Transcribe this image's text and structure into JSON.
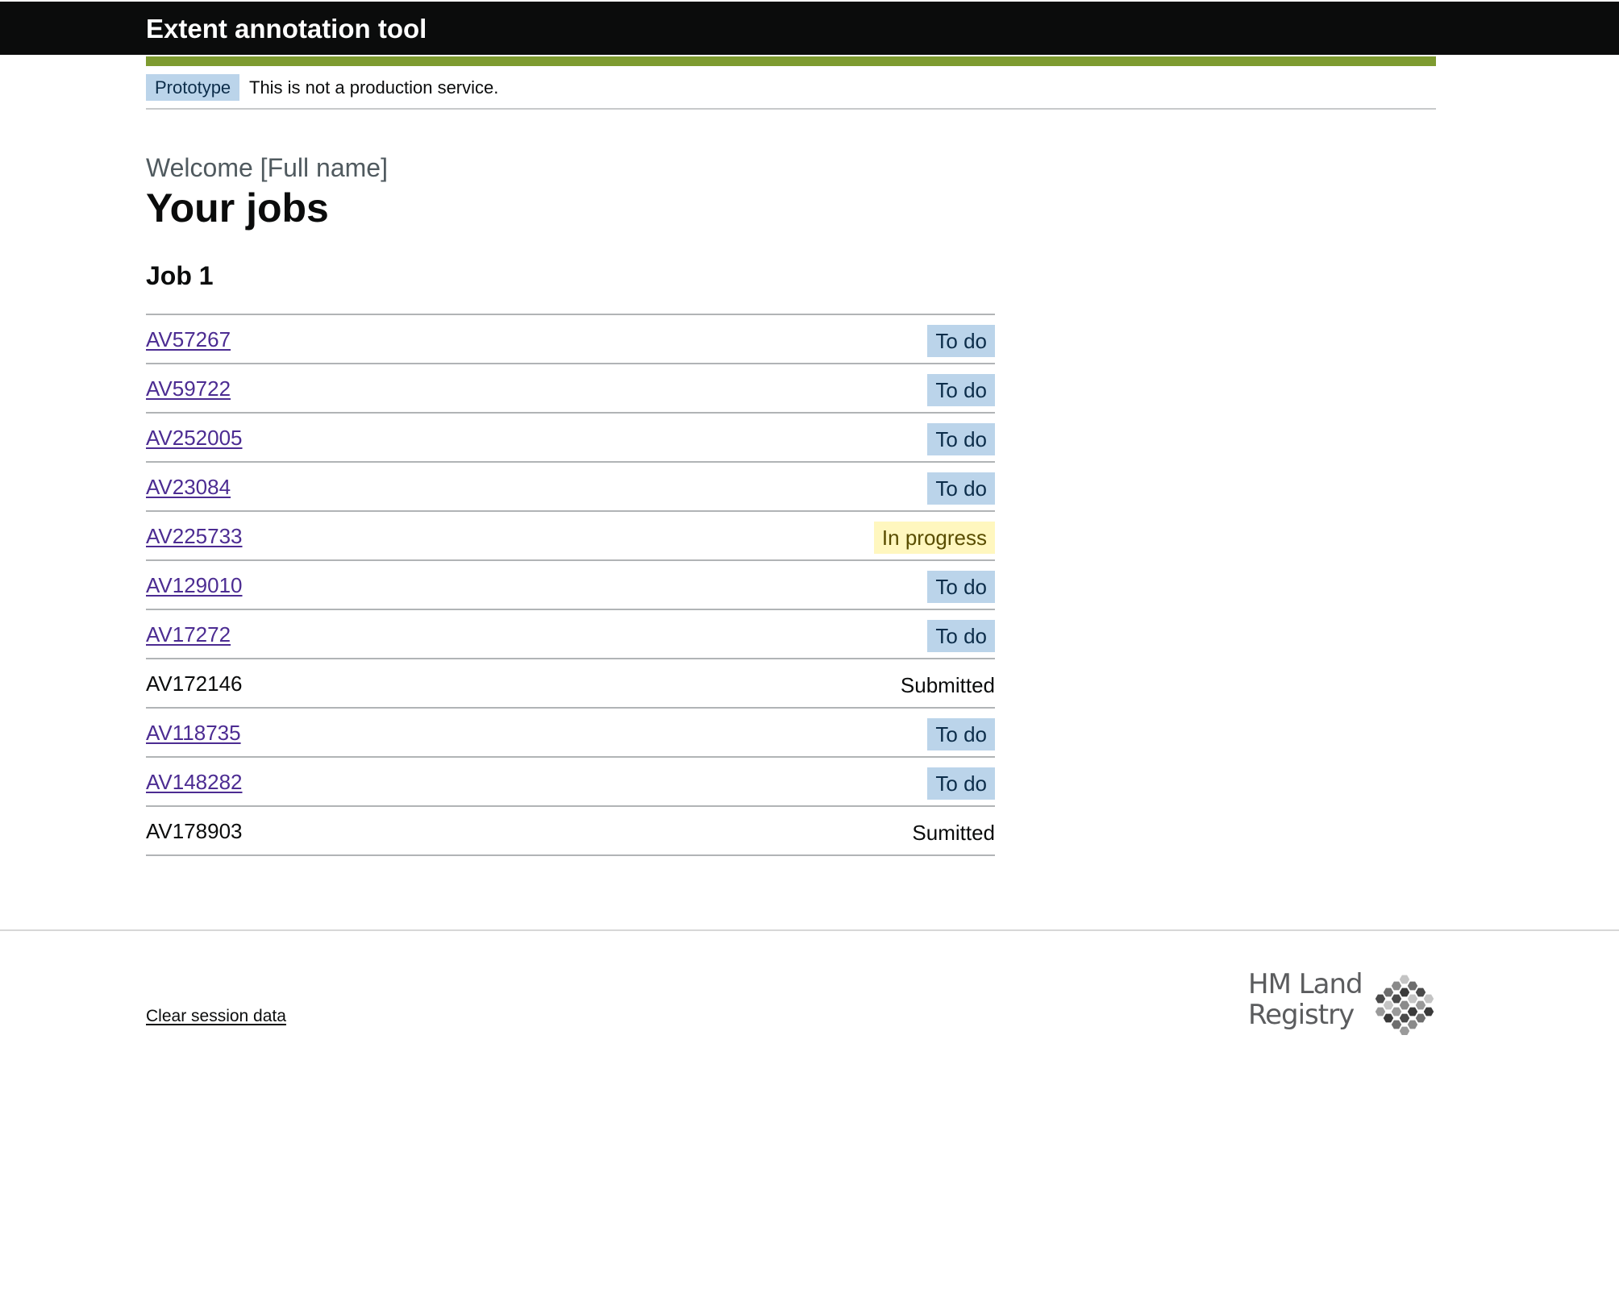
{
  "header": {
    "title": "Extent annotation tool"
  },
  "phase_banner": {
    "tag": "Prototype",
    "text": "This is not a production service."
  },
  "page": {
    "caption": "Welcome [Full name]",
    "title": "Your jobs"
  },
  "job": {
    "heading": "Job 1",
    "rows": [
      {
        "id": "AV57267",
        "status": "To do",
        "link": true
      },
      {
        "id": "AV59722",
        "status": "To do",
        "link": true
      },
      {
        "id": "AV252005",
        "status": "To do",
        "link": true
      },
      {
        "id": "AV23084",
        "status": "To do",
        "link": true
      },
      {
        "id": "AV225733",
        "status": "In progress",
        "link": true
      },
      {
        "id": "AV129010",
        "status": "To do",
        "link": true
      },
      {
        "id": "AV17272",
        "status": "To do",
        "link": true
      },
      {
        "id": "AV172146",
        "status": "Submitted",
        "link": false
      },
      {
        "id": "AV118735",
        "status": "To do",
        "link": true
      },
      {
        "id": "AV148282",
        "status": "To do",
        "link": true
      },
      {
        "id": "AV178903",
        "status": "Sumitted",
        "link": false
      }
    ]
  },
  "footer": {
    "clear_session": "Clear session data",
    "logo_line1": "HM Land",
    "logo_line2": "Registry",
    "logo_icon": "hmlr-crest-icon"
  },
  "colors": {
    "header_bg": "#0b0c0c",
    "accent_green": "#7e9b30",
    "tag_blue": "#bbd4ea",
    "tag_yellow": "#fff7bf",
    "link_purple": "#4c2c92"
  }
}
